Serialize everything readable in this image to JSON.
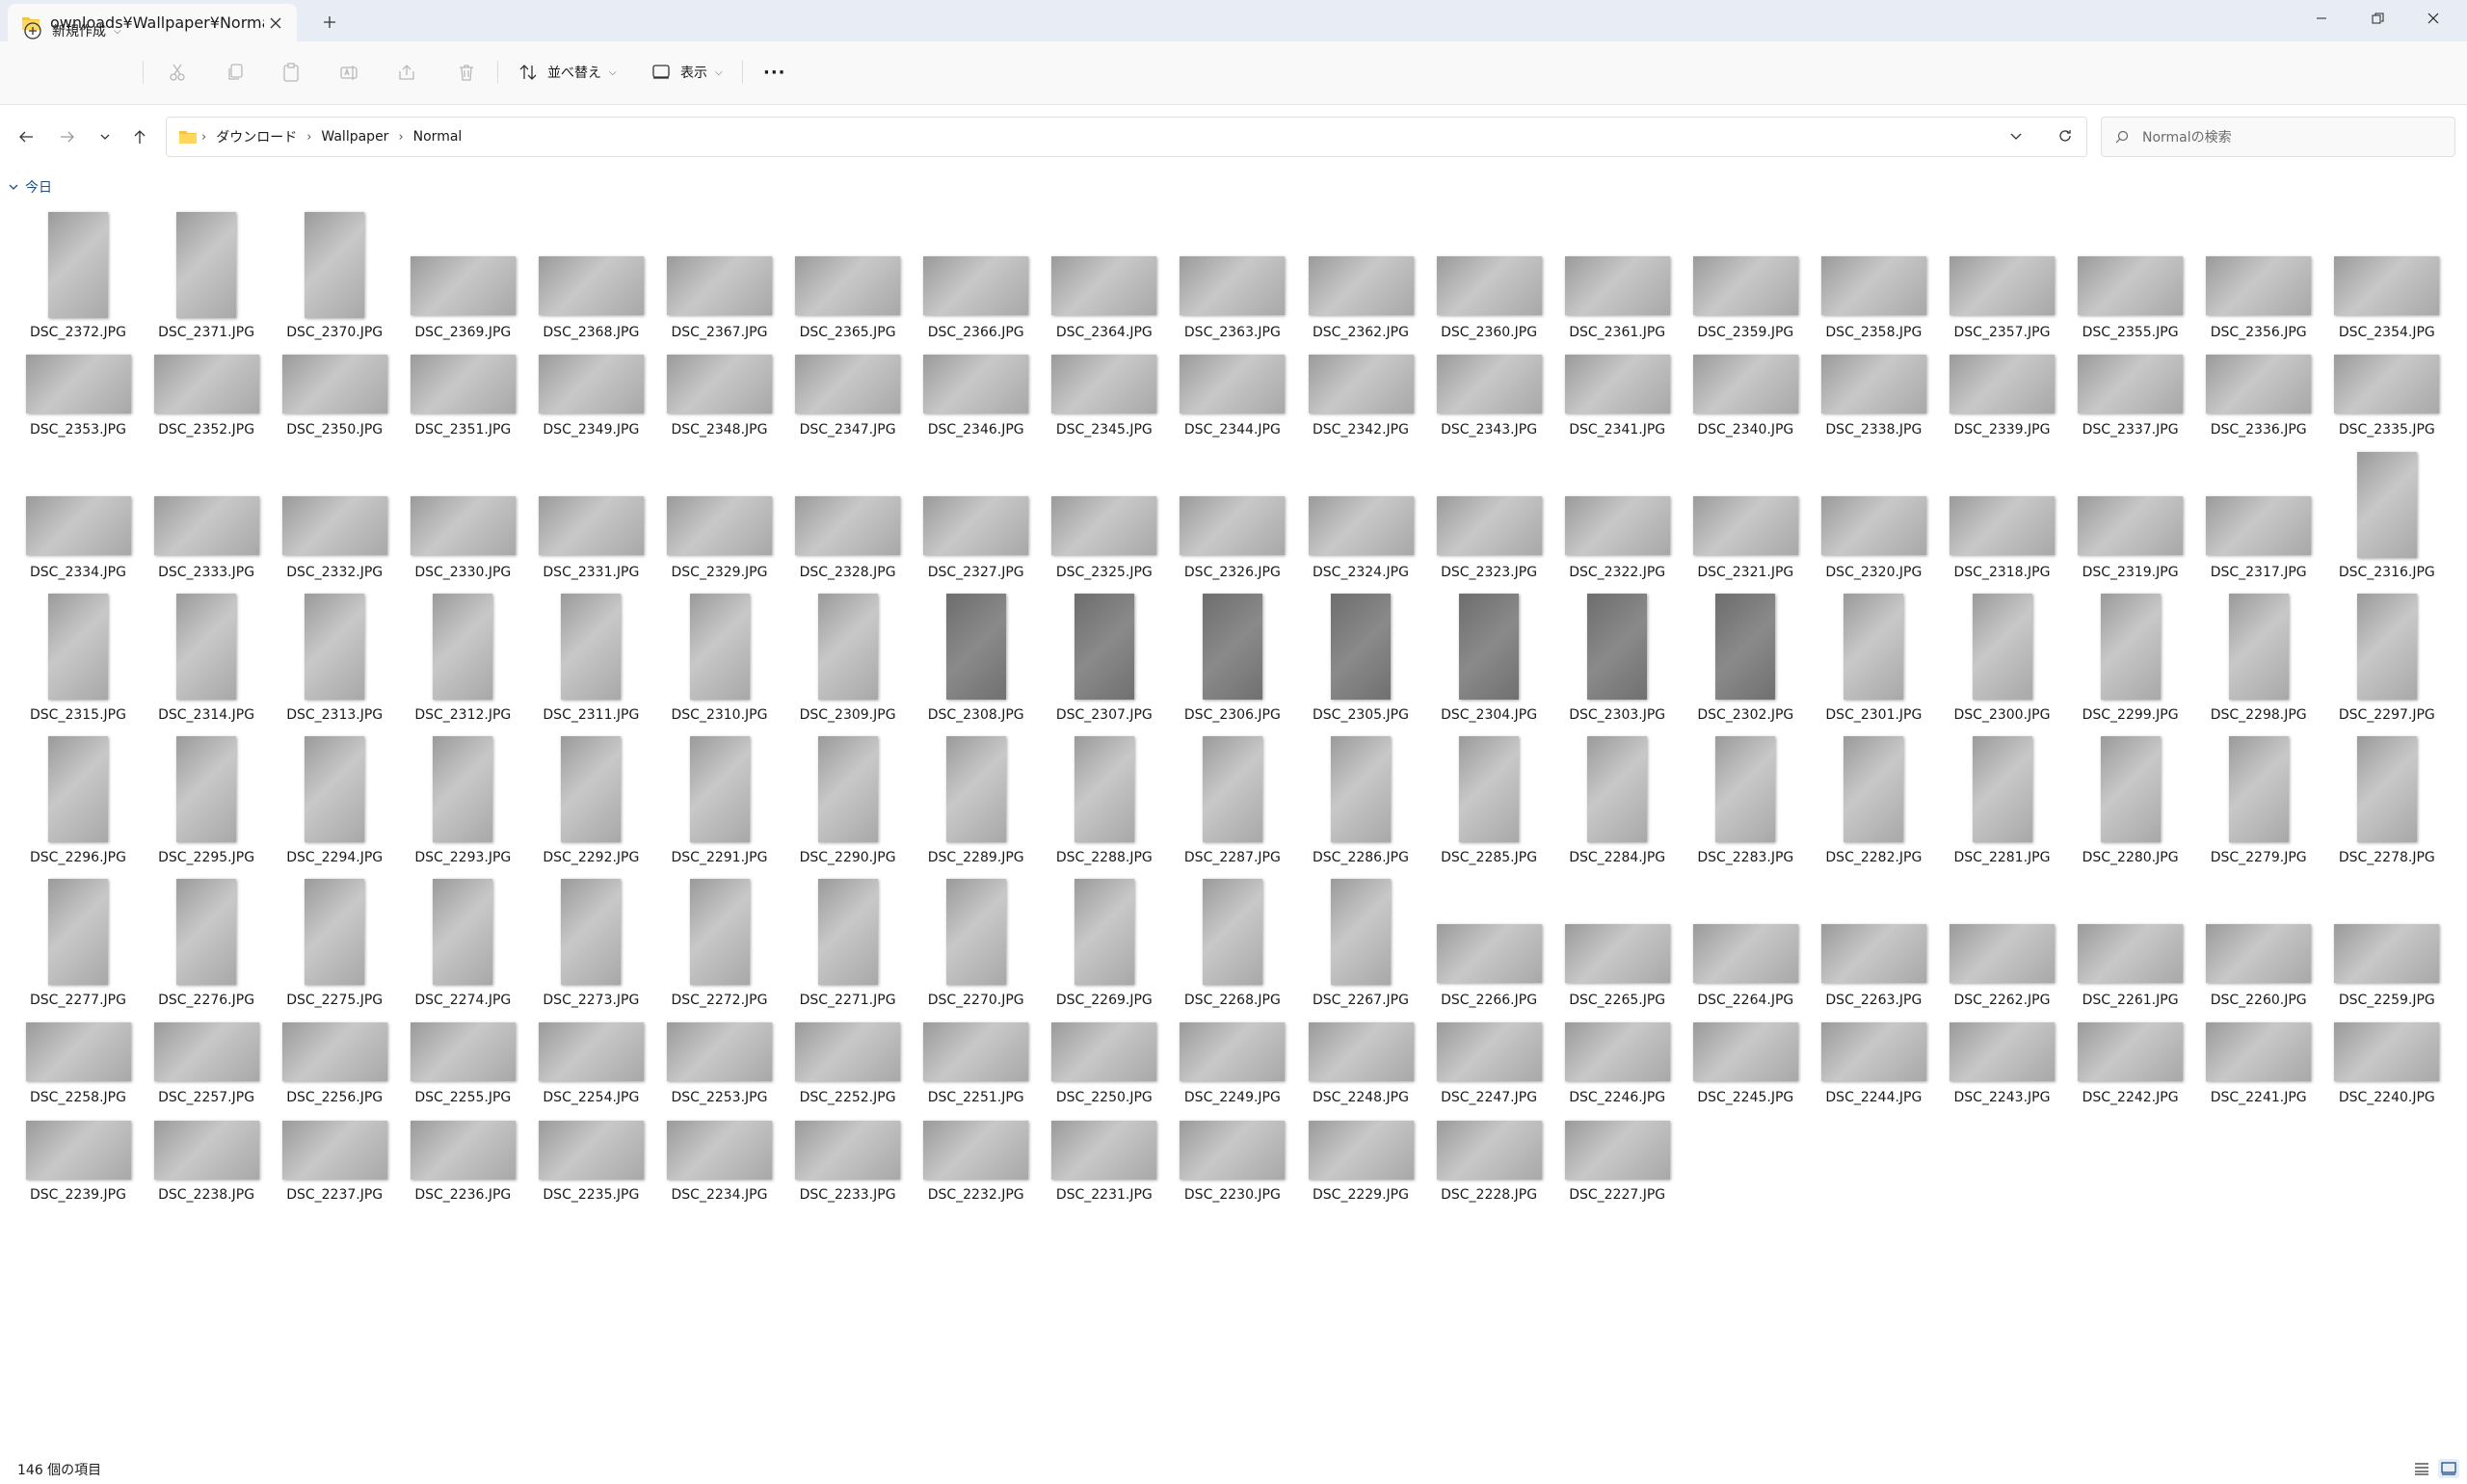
{
  "window": {
    "tab_title": "ownloads¥Wallpaper¥Normal",
    "new_tab_label": "+"
  },
  "toolbar": {
    "new_label": "新規作成",
    "sort_label": "並べ替え",
    "view_label": "表示",
    "more_label": "···"
  },
  "address": {
    "crumbs": [
      "ダウンロード",
      "Wallpaper",
      "Normal"
    ]
  },
  "search": {
    "placeholder": "Normalの検索"
  },
  "group": {
    "label": "今日"
  },
  "status": {
    "count": "146 個の項目"
  },
  "files": {
    "rows": [
      [
        "DSC_2372.JPG",
        "DSC_2371.JPG",
        "DSC_2370.JPG",
        "DSC_2369.JPG",
        "DSC_2368.JPG",
        "DSC_2367.JPG",
        "DSC_2365.JPG",
        "DSC_2366.JPG",
        "DSC_2364.JPG",
        "DSC_2363.JPG",
        "DSC_2362.JPG",
        "DSC_2360.JPG",
        "DSC_2361.JPG",
        "DSC_2359.JPG",
        "DSC_2358.JPG",
        "DSC_2357.JPG",
        "DSC_2355.JPG",
        "DSC_2356.JPG",
        "DSC_2354.JPG"
      ],
      [
        "DSC_2353.JPG",
        "DSC_2352.JPG",
        "DSC_2350.JPG",
        "DSC_2351.JPG",
        "DSC_2349.JPG",
        "DSC_2348.JPG",
        "DSC_2347.JPG",
        "DSC_2346.JPG",
        "DSC_2345.JPG",
        "DSC_2344.JPG",
        "DSC_2342.JPG",
        "DSC_2343.JPG",
        "DSC_2341.JPG",
        "DSC_2340.JPG",
        "DSC_2338.JPG",
        "DSC_2339.JPG",
        "DSC_2337.JPG",
        "DSC_2336.JPG",
        "DSC_2335.JPG"
      ],
      [
        "DSC_2334.JPG",
        "DSC_2333.JPG",
        "DSC_2332.JPG",
        "DSC_2330.JPG",
        "DSC_2331.JPG",
        "DSC_2329.JPG",
        "DSC_2328.JPG",
        "DSC_2327.JPG",
        "DSC_2325.JPG",
        "DSC_2326.JPG",
        "DSC_2324.JPG",
        "DSC_2323.JPG",
        "DSC_2322.JPG",
        "DSC_2321.JPG",
        "DSC_2320.JPG",
        "DSC_2318.JPG",
        "DSC_2319.JPG",
        "DSC_2317.JPG",
        "DSC_2316.JPG"
      ],
      [
        "DSC_2315.JPG",
        "DSC_2314.JPG",
        "DSC_2313.JPG",
        "DSC_2312.JPG",
        "DSC_2311.JPG",
        "DSC_2310.JPG",
        "DSC_2309.JPG",
        "DSC_2308.JPG",
        "DSC_2307.JPG",
        "DSC_2306.JPG",
        "DSC_2305.JPG",
        "DSC_2304.JPG",
        "DSC_2303.JPG",
        "DSC_2302.JPG",
        "DSC_2301.JPG",
        "DSC_2300.JPG",
        "DSC_2299.JPG",
        "DSC_2298.JPG",
        "DSC_2297.JPG"
      ],
      [
        "DSC_2296.JPG",
        "DSC_2295.JPG",
        "DSC_2294.JPG",
        "DSC_2293.JPG",
        "DSC_2292.JPG",
        "DSC_2291.JPG",
        "DSC_2290.JPG",
        "DSC_2289.JPG",
        "DSC_2288.JPG",
        "DSC_2287.JPG",
        "DSC_2286.JPG",
        "DSC_2285.JPG",
        "DSC_2284.JPG",
        "DSC_2283.JPG",
        "DSC_2282.JPG",
        "DSC_2281.JPG",
        "DSC_2280.JPG",
        "DSC_2279.JPG",
        "DSC_2278.JPG"
      ],
      [
        "DSC_2277.JPG",
        "DSC_2276.JPG",
        "DSC_2275.JPG",
        "DSC_2274.JPG",
        "DSC_2273.JPG",
        "DSC_2272.JPG",
        "DSC_2271.JPG",
        "DSC_2270.JPG",
        "DSC_2269.JPG",
        "DSC_2268.JPG",
        "DSC_2267.JPG",
        "DSC_2266.JPG",
        "DSC_2265.JPG",
        "DSC_2264.JPG",
        "DSC_2263.JPG",
        "DSC_2262.JPG",
        "DSC_2261.JPG",
        "DSC_2260.JPG",
        "DSC_2259.JPG"
      ],
      [
        "DSC_2258.JPG",
        "DSC_2257.JPG",
        "DSC_2256.JPG",
        "DSC_2255.JPG",
        "DSC_2254.JPG",
        "DSC_2253.JPG",
        "DSC_2252.JPG",
        "DSC_2251.JPG",
        "DSC_2250.JPG",
        "DSC_2249.JPG",
        "DSC_2248.JPG",
        "DSC_2247.JPG",
        "DSC_2246.JPG",
        "DSC_2245.JPG",
        "DSC_2244.JPG",
        "DSC_2243.JPG",
        "DSC_2242.JPG",
        "DSC_2241.JPG",
        "DSC_2240.JPG"
      ],
      [
        "DSC_2239.JPG",
        "DSC_2238.JPG",
        "DSC_2237.JPG",
        "DSC_2236.JPG",
        "DSC_2235.JPG",
        "DSC_2234.JPG",
        "DSC_2233.JPG",
        "DSC_2232.JPG",
        "DSC_2231.JPG",
        "DSC_2230.JPG",
        "DSC_2229.JPG",
        "DSC_2228.JPG",
        "DSC_2227.JPG"
      ]
    ],
    "orientations": [
      "pppllllllllllllllll",
      "lllllllllllllllllll",
      "llllllllllllllllllp",
      "ppppppppppppppppppp",
      "ppppppppppppppppppp",
      "pppppppppppllllllll",
      "lllllllllllllllllll",
      "lllllllllllll"
    ],
    "dark_row3_from": 7,
    "dark_row3_to": 13
  }
}
